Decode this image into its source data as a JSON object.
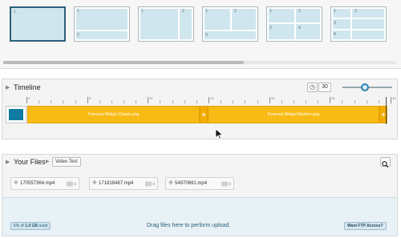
{
  "layouts": {
    "options": [
      {
        "cells": [
          "1"
        ],
        "selected": true
      },
      {
        "cells": [
          "1",
          "2"
        ],
        "selected": false
      },
      {
        "cells": [
          "1",
          "2"
        ],
        "selected": false
      },
      {
        "cells": [
          "1",
          "2",
          "3"
        ],
        "selected": false
      },
      {
        "cells": [
          "1",
          "2",
          "3",
          "4"
        ],
        "selected": false
      },
      {
        "cells": [
          "1",
          "2",
          "3",
          "4"
        ],
        "selected": false
      }
    ]
  },
  "timeline": {
    "title": "Timeline",
    "duration_value": "30",
    "zoom_level": 0.45,
    "ruler_labels": [
      "0",
      "5",
      "10",
      "15",
      "20",
      "25",
      "30"
    ],
    "track_color": "#0f7ba2",
    "clips": [
      {
        "label": "Forecast Widget Classic.png",
        "color": "#f8bb16"
      },
      {
        "label": "Forecast Widget Modern.png",
        "color": "#f8bb16"
      }
    ],
    "clip_handle_symbol": "+"
  },
  "files": {
    "title": "Your Files",
    "breadcrumb_folder": "Video Test",
    "items": [
      {
        "name": "170557364.mp4"
      },
      {
        "name": "171818487.mp4"
      },
      {
        "name": "54970691.mp4"
      }
    ],
    "upload": {
      "usage_prefix": "6% of",
      "usage_amount": "1.0 GB",
      "usage_suffix": "used",
      "drop_hint": "Drag files here to perform upload.",
      "ftp_label": "Want FTP Access?"
    }
  },
  "icons": {
    "panel_toggle": "chevron-right-icon",
    "clock": "clock-icon",
    "search": "search-icon",
    "file_grip": "grip-icon",
    "file_type": "camera-icon"
  }
}
